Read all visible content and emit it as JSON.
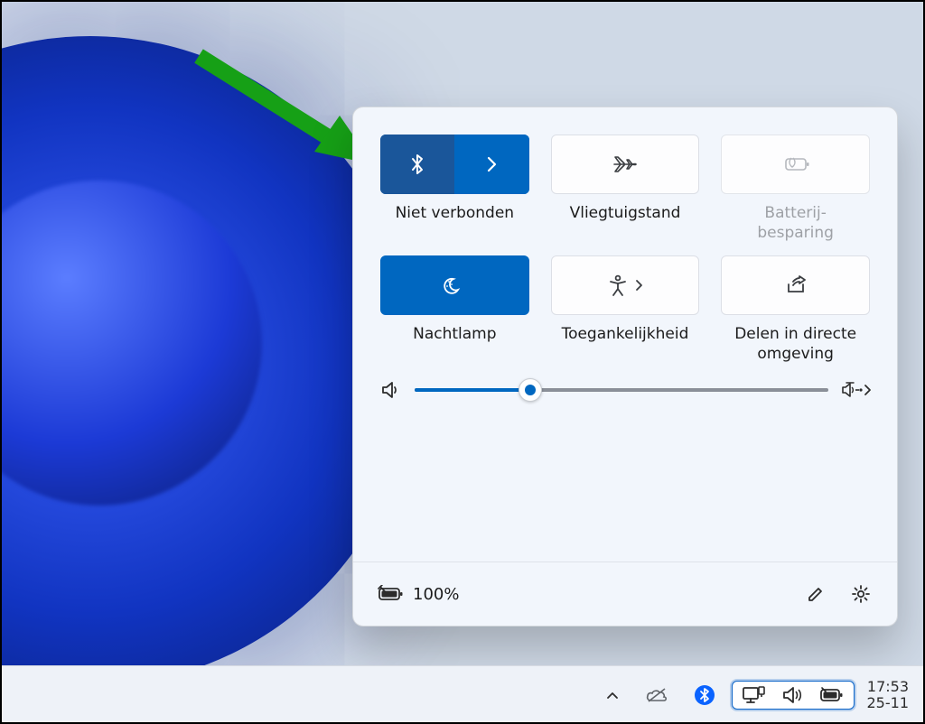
{
  "tiles": {
    "bluetooth": {
      "label": "Niet verbonden"
    },
    "airplane": {
      "label": "Vliegtuigstand"
    },
    "battery": {
      "label": "Batterij-\nbesparing"
    },
    "nightlight": {
      "label": "Nachtlamp"
    },
    "accessibility": {
      "label": "Toegankelijkheid"
    },
    "share": {
      "label": "Delen in directe omgeving"
    }
  },
  "volume": {
    "percent": 28
  },
  "footer": {
    "battery_text": "100%"
  },
  "taskbar": {
    "time": "17:53",
    "date": "25-11"
  }
}
